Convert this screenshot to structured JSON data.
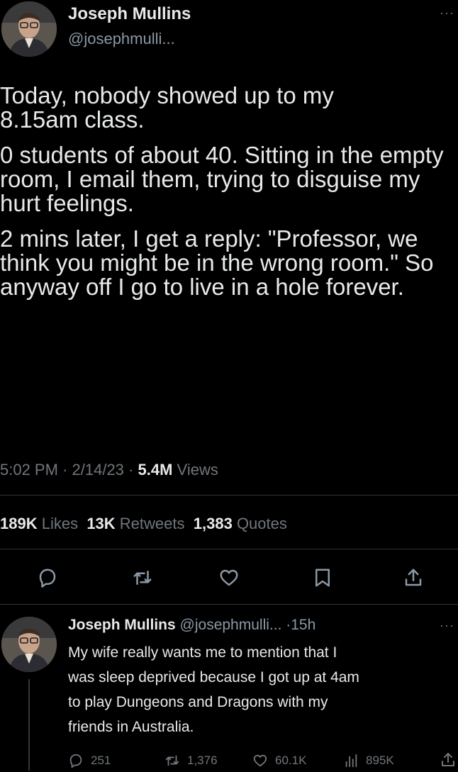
{
  "tweet": {
    "author_name": "Joseph Mullins",
    "author_handle": "@josephmulli...",
    "paragraphs": [
      "Today, nobody showed up to my 8.15am class.",
      "0 students of about 40.  Sitting in the empty room, I email them, trying to disguise my hurt feelings.",
      "2 mins later, I get a reply: \"Professor, we think you might be in the wrong room.\" So anyway off I go to live in a hole forever."
    ],
    "time": "5:02 PM",
    "date": "2/14/23",
    "views_count": "5.4M",
    "views_label": "Views",
    "likes_count": "189K",
    "likes_label": "Likes",
    "retweets_count": "13K",
    "retweets_label": "Retweets",
    "quotes_count": "1,383",
    "quotes_label": "Quotes",
    "more_icon": "more-dots-icon"
  },
  "actions": {
    "icons": [
      "reply-icon",
      "retweet-icon",
      "like-icon",
      "bookmark-icon",
      "share-icon"
    ]
  },
  "reply": {
    "author_name": "Joseph Mullins",
    "author_handle": "@josephmulli...",
    "age": "15h",
    "text_lines": [
      "My wife really wants me to mention that I",
      "was sleep deprived because I got up at 4am",
      "to play Dungeons and Dragons with my",
      "friends in Australia."
    ],
    "replies": "251",
    "retweets": "1,376",
    "likes": "60.1K",
    "views": "895K"
  },
  "colors": {
    "background": "#000000",
    "text": "#e7e9ea",
    "secondary": "#71767b",
    "divider": "#2f3336"
  }
}
